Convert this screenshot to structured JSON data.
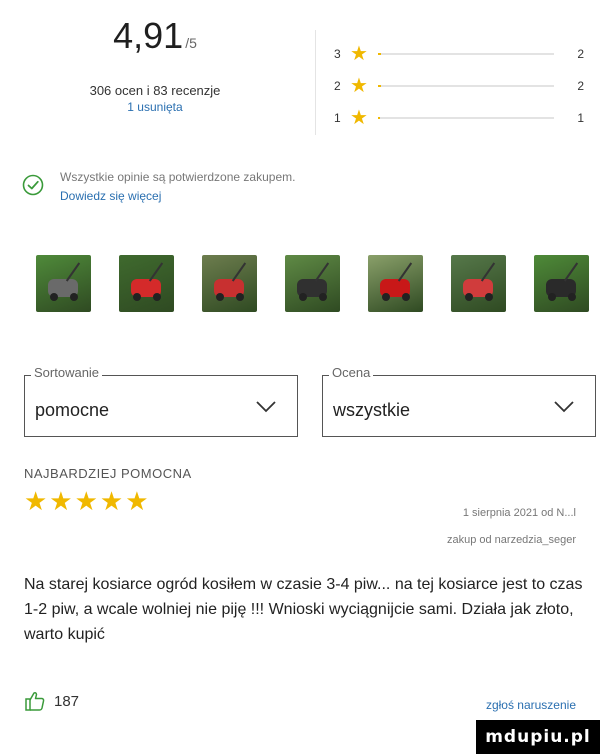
{
  "summary": {
    "score": "4,91",
    "score_max": "/5",
    "counts_line": "306 ocen i 83 recenzje",
    "removed_line": "1 usunięta"
  },
  "histogram": [
    {
      "stars": "3",
      "count": "2",
      "fill": 0.02
    },
    {
      "stars": "2",
      "count": "2",
      "fill": 0.02
    },
    {
      "stars": "1",
      "count": "1",
      "fill": 0.01
    }
  ],
  "verified": {
    "text": "Wszystkie opinie są potwierdzone zakupem.",
    "link": "Dowiedz się więcej"
  },
  "photos": [
    {
      "name": "photo-1",
      "bg": "#4f8a3a",
      "accent": "#6a6a6a"
    },
    {
      "name": "photo-2",
      "bg": "#3f6a2e",
      "accent": "#d42a2a"
    },
    {
      "name": "photo-3",
      "bg": "#6d7d4e",
      "accent": "#c83030"
    },
    {
      "name": "photo-4",
      "bg": "#5f8a45",
      "accent": "#303030"
    },
    {
      "name": "photo-5",
      "bg": "#8aa06a",
      "accent": "#c81818"
    },
    {
      "name": "photo-6",
      "bg": "#56784a",
      "accent": "#d03c3c"
    },
    {
      "name": "photo-7",
      "bg": "#4e8a38",
      "accent": "#2a2a2a"
    }
  ],
  "sort": {
    "label": "Sortowanie",
    "value": "pomocne"
  },
  "filter": {
    "label": "Ocena",
    "value": "wszystkie"
  },
  "review": {
    "section_title": "NAJBARDZIEJ POMOCNA",
    "stars": "★★★★★",
    "date_author": "1 sierpnia 2021 od N...l",
    "shop": "zakup od narzedzia_seger",
    "body": "Na starej kosiarce ogród kosiłem w czasie 3-4 piw... na tej kosiarce jest to czas 1-2 piw, a wcale wolniej nie piję !!! Wnioski wyciągnijcie sami. Działa jak złoto, warto kupić",
    "likes": "187",
    "report": "zgłoś naruszenie"
  },
  "watermark": "mdupiu.pl",
  "colors": {
    "star": "#f0b800",
    "link": "#2a6fb0",
    "check": "#3a9a3a"
  }
}
